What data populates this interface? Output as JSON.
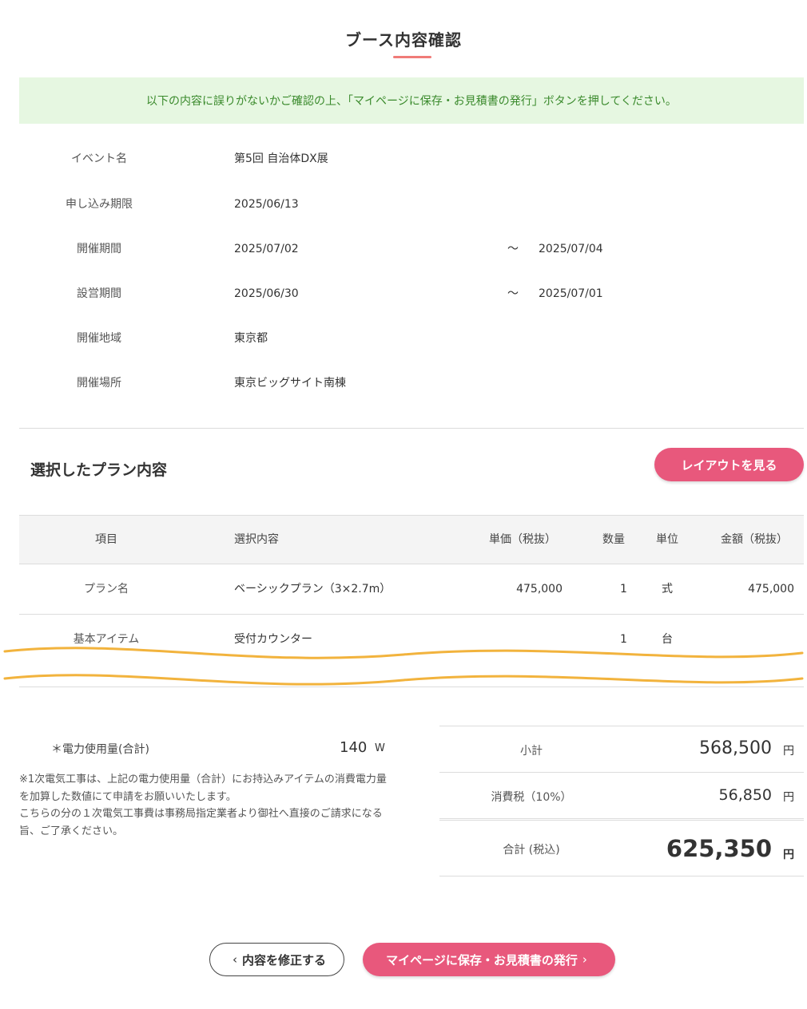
{
  "page": {
    "title": "ブース内容確認",
    "notice": "以下の内容に誤りがないかご確認の上、「マイページに保存・お見積書の発行」ボタンを押してください。"
  },
  "event_info": [
    {
      "label": "イベント名",
      "value": "第5回 自治体DX展",
      "value2": ""
    },
    {
      "label": "申し込み期限",
      "value": "2025/06/13",
      "value2": ""
    },
    {
      "label": "開催期間",
      "value": "2025/07/02",
      "tilde": "〜",
      "value2": "2025/07/04"
    },
    {
      "label": "設営期間",
      "value": "2025/06/30",
      "tilde": "〜",
      "value2": "2025/07/01"
    },
    {
      "label": "開催地域",
      "value": "東京都",
      "value2": ""
    },
    {
      "label": "開催場所",
      "value": "東京ビッグサイト南棟",
      "value2": ""
    }
  ],
  "plan": {
    "heading": "選択したプラン内容",
    "layout_button": "レイアウトを見る",
    "columns": {
      "item": "項目",
      "selection": "選択内容",
      "unit_price": "単価（税抜）",
      "quantity": "数量",
      "unit": "単位",
      "amount": "金額（税抜）"
    },
    "rows": [
      {
        "item": "プラン名",
        "selection": "ベーシックプラン（3×2.7m）",
        "unit_price": "475,000",
        "quantity": "1",
        "unit": "式",
        "amount": "475,000"
      },
      {
        "item": "基本アイテム",
        "selection": "受付カウンター",
        "unit_price": "",
        "quantity": "1",
        "unit": "台",
        "amount": ""
      }
    ]
  },
  "power": {
    "label": "＊電力使用量(合計)",
    "value": "140",
    "unit": "W",
    "note": "※1次電気工事は、上記の電力使用量（合計）にお持込みアイテムの消費電力量を加算した数値にて申請をお願いいたします。\nこちらの分の１次電気工事費は事務局指定業者より御社へ直接のご請求になる旨、ご了承ください。"
  },
  "summary": {
    "subtotal_label": "小計",
    "subtotal_value": "568,500",
    "tax_label": "消費税（10%）",
    "tax_value": "56,850",
    "total_label": "合計 (税込)",
    "total_value": "625,350",
    "currency": "円"
  },
  "actions": {
    "edit_label": "内容を修正する",
    "save_label": "マイページに保存・お見積書の発行",
    "edit_chevron": "‹",
    "save_chevron": "›"
  },
  "colors": {
    "accent": "#e8587c",
    "notice_bg": "#e6f7e1",
    "notice_text": "#3a8a2c",
    "wave": "#f2b33d"
  }
}
